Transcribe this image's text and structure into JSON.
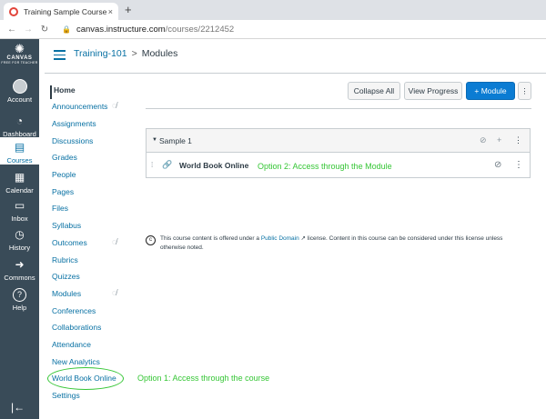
{
  "browser": {
    "tab_title": "Training Sample Course",
    "tab_close": "×",
    "new_tab": "+",
    "url_host": "canvas.instructure.com",
    "url_path": "/courses/2212452"
  },
  "global_nav": {
    "logo_word": "CANVAS",
    "logo_sub": "FREE FOR TEACHER",
    "items": [
      {
        "label": "Account"
      },
      {
        "label": "Dashboard"
      },
      {
        "label": "Courses"
      },
      {
        "label": "Calendar"
      },
      {
        "label": "Inbox"
      },
      {
        "label": "History"
      },
      {
        "label": "Commons"
      },
      {
        "label": "Help"
      }
    ]
  },
  "breadcrumb": {
    "course": "Training-101",
    "separator": ">",
    "current": "Modules"
  },
  "course_nav": [
    {
      "label": "Home",
      "active": true
    },
    {
      "label": "Announcements",
      "hidden": true
    },
    {
      "label": "Assignments"
    },
    {
      "label": "Discussions"
    },
    {
      "label": "Grades"
    },
    {
      "label": "People"
    },
    {
      "label": "Pages"
    },
    {
      "label": "Files"
    },
    {
      "label": "Syllabus"
    },
    {
      "label": "Outcomes",
      "hidden": true
    },
    {
      "label": "Rubrics"
    },
    {
      "label": "Quizzes"
    },
    {
      "label": "Modules",
      "hidden": true
    },
    {
      "label": "Conferences"
    },
    {
      "label": "Collaborations"
    },
    {
      "label": "Attendance"
    },
    {
      "label": "New Analytics"
    },
    {
      "label": "World Book Online"
    },
    {
      "label": "Settings"
    }
  ],
  "toolbar": {
    "collapse_all": "Collapse All",
    "view_progress": "View Progress",
    "add_module": "+ Module",
    "more": "⋮"
  },
  "module": {
    "name": "Sample 1",
    "item_name": "World Book Online"
  },
  "annotations": {
    "option2": "Option 2: Access through the Module",
    "option1": "Option 1: Access through the course"
  },
  "license": {
    "before": "This course content is offered under a ",
    "link": "Public Domain",
    "after": " license. Content in this course can be considered under this license unless otherwise noted."
  },
  "colors": {
    "nav_bg": "#394b58",
    "link": "#0770a3",
    "primary_button": "#0b7cd3",
    "highlight_green": "#35c635"
  }
}
